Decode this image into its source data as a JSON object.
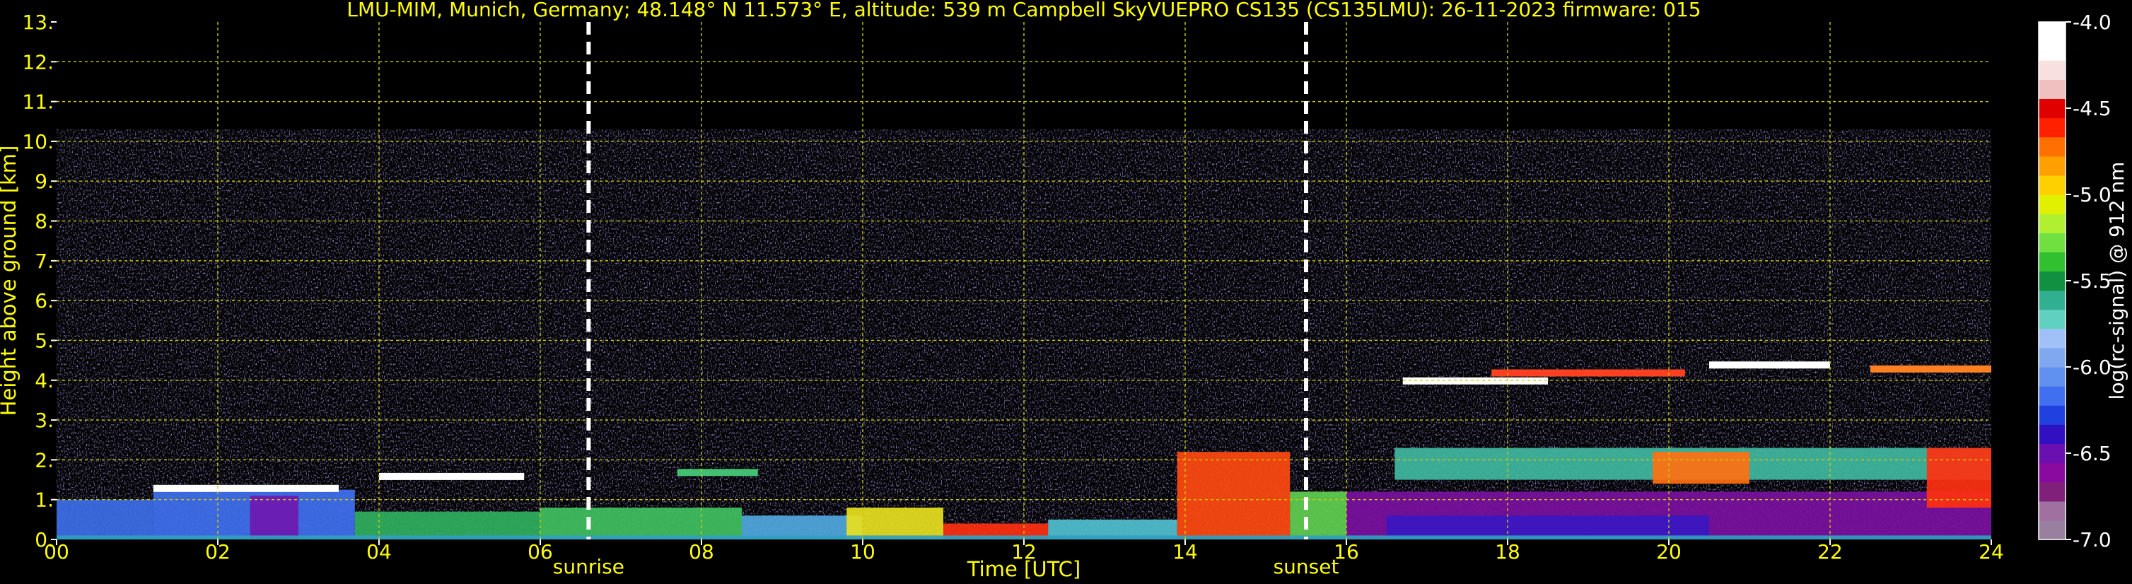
{
  "chart_data": {
    "type": "heatmap",
    "title": "LMU-MIM, Munich, Germany; 48.148° N 11.573° E, altitude: 539 m    Campbell SkyVUEPRO CS135 (CS135LMU): 26-11-2023    firmware: 015",
    "xlabel": "Time [UTC]",
    "ylabel": "Height above ground [km]",
    "xlim": [
      0,
      24
    ],
    "ylim": [
      0,
      13
    ],
    "x_ticks": [
      "00",
      "02",
      "04",
      "06",
      "08",
      "10",
      "12",
      "14",
      "16",
      "18",
      "20",
      "22",
      "24"
    ],
    "y_ticks": [
      "0.",
      "1.",
      "2.",
      "3.",
      "4.",
      "5.",
      "6.",
      "7.",
      "8.",
      "9.",
      "10.",
      "11.",
      "12.",
      "13."
    ],
    "grid": true,
    "events": [
      {
        "label": "sunrise",
        "time": 6.6
      },
      {
        "label": "sunset",
        "time": 15.5
      }
    ],
    "colorbar": {
      "label": "log(rc-signal) @ 912 nm",
      "range": [
        -7.0,
        -4.0
      ],
      "ticks": [
        "-4.0",
        "-4.5",
        "-5.0",
        "-5.5",
        "-6.0",
        "-6.5",
        "-7.0"
      ],
      "colors": [
        "#9a80a0",
        "#a070a0",
        "#80207a",
        "#8a0aa0",
        "#6a10b0",
        "#3010c0",
        "#2040e0",
        "#4070f0",
        "#6090f0",
        "#80a8f0",
        "#a0c0f8",
        "#60d0c0",
        "#30b090",
        "#109040",
        "#30c030",
        "#70e040",
        "#b0f030",
        "#e0f000",
        "#ffd000",
        "#ffa000",
        "#ff7000",
        "#ff2000",
        "#e00000",
        "#f0c0c0",
        "#f8e0e0",
        "#ffffff",
        "#ffffff"
      ]
    },
    "bands": [
      {
        "start": 0.0,
        "end": 1.2,
        "top": 1.0,
        "color": "#3d6ee8"
      },
      {
        "start": 1.2,
        "end": 3.7,
        "top": 1.25,
        "color": "#4070f0"
      },
      {
        "start": 2.4,
        "end": 3.0,
        "top": 1.1,
        "color": "#7018b0"
      },
      {
        "start": 3.7,
        "end": 6.0,
        "top": 0.7,
        "color": "#30b060"
      },
      {
        "start": 6.0,
        "end": 8.5,
        "top": 0.8,
        "color": "#40c060"
      },
      {
        "start": 8.5,
        "end": 10.0,
        "top": 0.6,
        "color": "#50a8e0"
      },
      {
        "start": 9.8,
        "end": 11.0,
        "top": 0.8,
        "color": "#e8e020"
      },
      {
        "start": 11.0,
        "end": 12.3,
        "top": 0.4,
        "color": "#ff3010"
      },
      {
        "start": 12.3,
        "end": 13.9,
        "top": 0.5,
        "color": "#50c0d0"
      },
      {
        "start": 13.9,
        "end": 15.3,
        "top": 2.2,
        "color": "#ff4a10"
      },
      {
        "start": 15.3,
        "end": 16.0,
        "top": 1.2,
        "color": "#60d050"
      },
      {
        "start": 16.0,
        "end": 24.0,
        "top": 1.2,
        "color": "#7a10a0"
      },
      {
        "start": 16.5,
        "end": 20.5,
        "top": 0.6,
        "color": "#3818c0"
      },
      {
        "start": 16.6,
        "end": 24.0,
        "top": 2.3,
        "color": "#40b8a0",
        "bottom": 1.5
      },
      {
        "start": 19.8,
        "end": 21.0,
        "top": 2.2,
        "color": "#ff7010",
        "bottom": 1.4
      },
      {
        "start": 23.2,
        "end": 24.0,
        "top": 2.3,
        "color": "#ff3010",
        "bottom": 0.8
      },
      {
        "start": 0.0,
        "end": 24.0,
        "top": 0.1,
        "color": "#30a0c0"
      }
    ],
    "cloud_layers": [
      {
        "start": 16.7,
        "end": 18.5,
        "height": 4.0,
        "color": "#ffffff"
      },
      {
        "start": 17.8,
        "end": 20.2,
        "height": 4.2,
        "color": "#ff4020"
      },
      {
        "start": 20.5,
        "end": 22.0,
        "height": 4.4,
        "color": "#ffffff"
      },
      {
        "start": 22.5,
        "end": 24.0,
        "height": 4.3,
        "color": "#ff8020"
      },
      {
        "start": 1.2,
        "end": 3.5,
        "height": 1.3,
        "color": "#ffffff"
      },
      {
        "start": 4.0,
        "end": 5.8,
        "height": 1.6,
        "color": "#ffffff"
      },
      {
        "start": 7.7,
        "end": 8.7,
        "height": 1.7,
        "color": "#40c070"
      }
    ],
    "signal_top_km": 10.3
  }
}
